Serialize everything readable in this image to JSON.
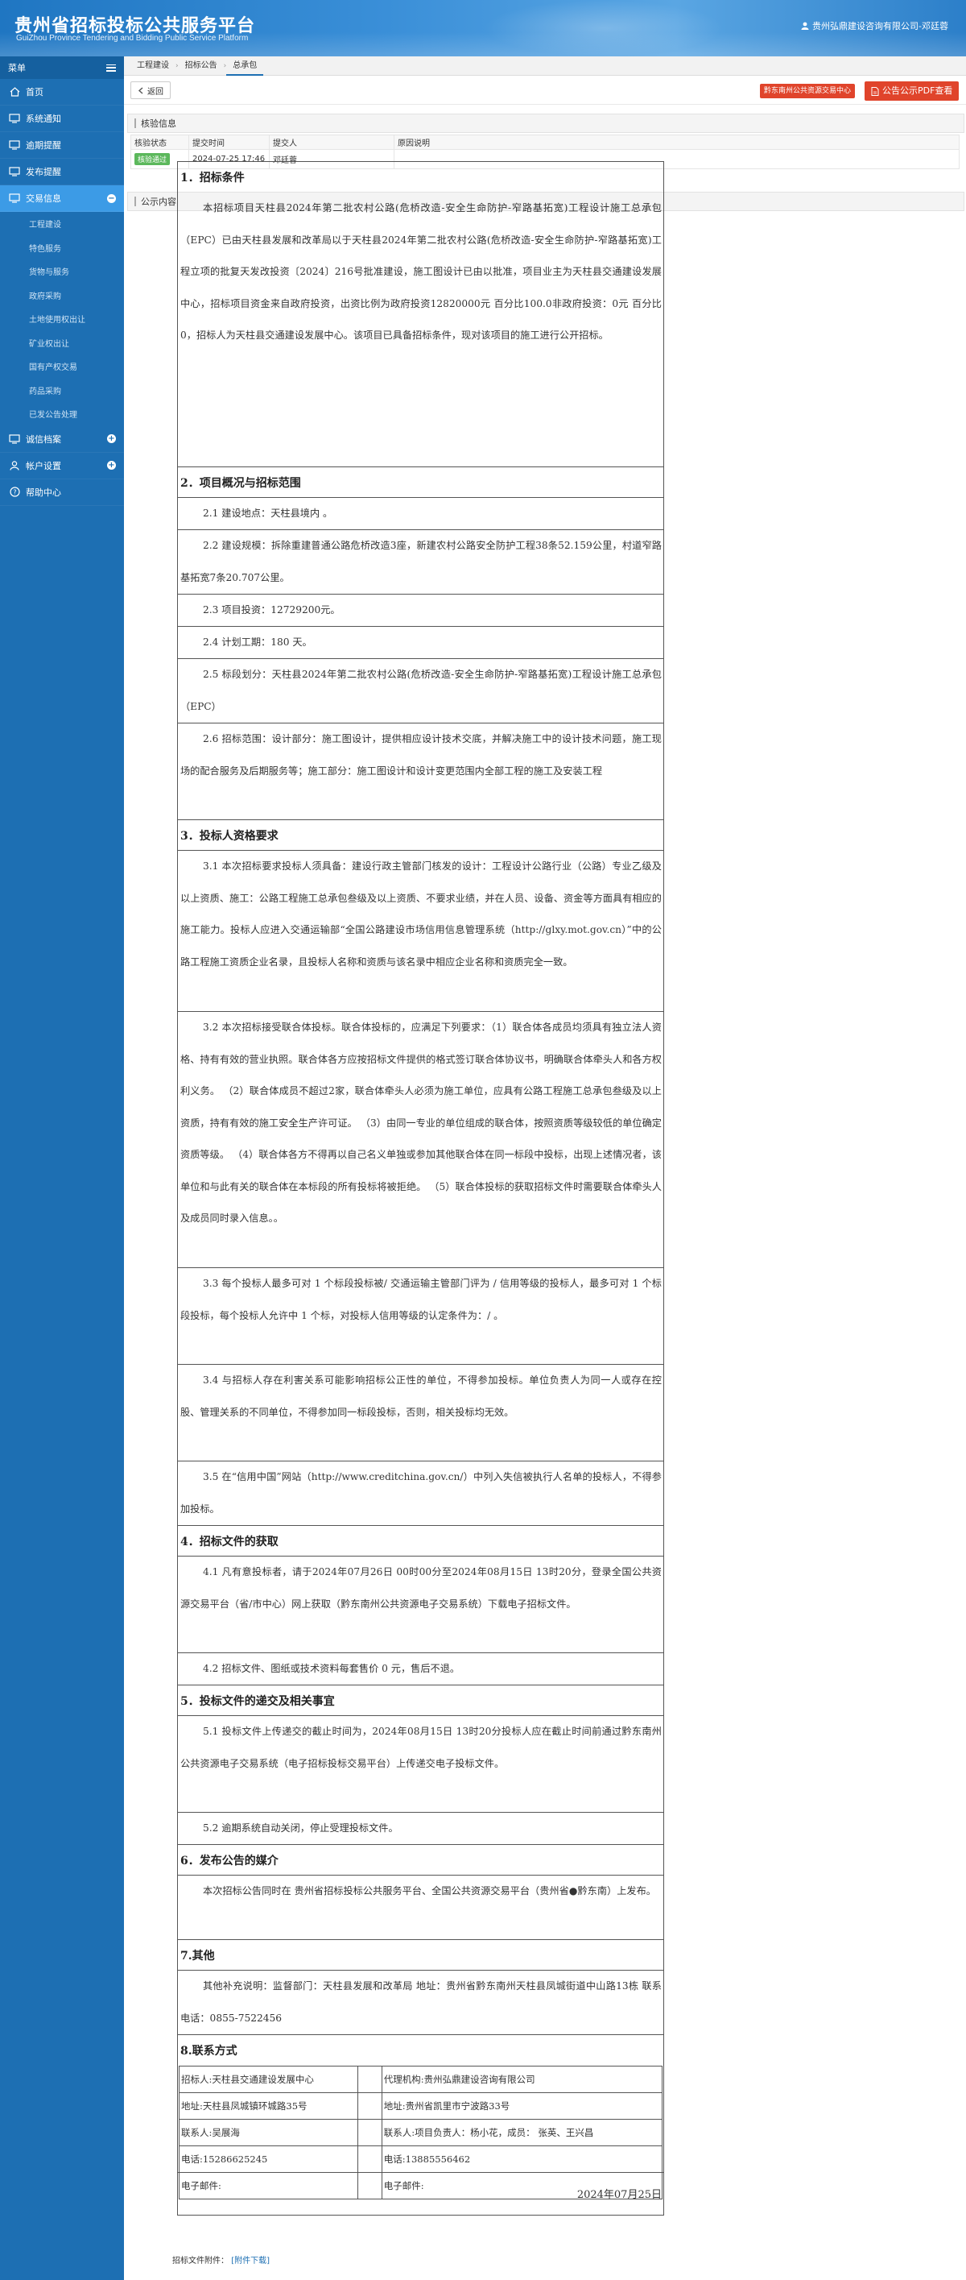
{
  "header": {
    "title": "贵州省招标投标公共服务平台",
    "subtitle": "GuiZhou Province Tendering and Bidding Public Service Platform",
    "user": "贵州弘鼎建设咨询有限公司-邓廷蓉"
  },
  "sidebar": {
    "menu_label": "菜单",
    "items": [
      {
        "label": "首页",
        "icon": "home-icon"
      },
      {
        "label": "系统通知",
        "icon": "monitor-icon"
      },
      {
        "label": "逾期提醒",
        "icon": "monitor-icon"
      },
      {
        "label": "发布提醒",
        "icon": "monitor-icon"
      },
      {
        "label": "交易信息",
        "icon": "monitor-icon"
      }
    ],
    "sub_items": [
      "工程建设",
      "特色服务",
      "货物与服务",
      "政府采购",
      "土地使用权出让",
      "矿业权出让",
      "国有产权交易",
      "药品采购",
      "已发公告处理"
    ],
    "bottom_items": [
      {
        "label": "诚信档案",
        "icon": "monitor-icon"
      },
      {
        "label": "帐户设置",
        "icon": "user-icon"
      },
      {
        "label": "帮助中心",
        "icon": "question-icon"
      }
    ]
  },
  "breadcrumb": [
    "工程建设",
    "招标公告",
    "总承包"
  ],
  "toolbar": {
    "back_label": "返回",
    "verify_label": "黔东南州公共资源交易中心",
    "pdf_label": "公告公示PDF查看"
  },
  "verify_section": {
    "title": "核验信息",
    "columns": [
      "核验状态",
      "提交时间",
      "提交人",
      "原因说明"
    ],
    "row": {
      "status": "核验通过",
      "time": "2024-07-25 17:46",
      "submitter": "邓廷蓉",
      "reason": ""
    }
  },
  "notice_section": {
    "title": "公示内容"
  },
  "document": {
    "s1_title": "1．招标条件",
    "s1_p1": "本招标项目天柱县2024年第二批农村公路(危桥改造-安全生命防护-窄路基拓宽)工程设计施工总承包（EPC）已由天柱县发展和改革局以于天柱县2024年第二批农村公路(危桥改造-安全生命防护-窄路基拓宽)工程立项的批复天发改投资〔2024〕216号批准建设，施工图设计已由以批准，项目业主为天柱县交通建设发展中心，招标项目资金来自政府投资，出资比例为政府投资12820000元 百分比100.0非政府投资：0元 百分比0，招标人为天柱县交通建设发展中心。该项目已具备招标条件，现对该项目的施工进行公开招标。",
    "s2_title": "2．项目概况与招标范围",
    "s2_p1": "2.1 建设地点：天柱县境内 。",
    "s2_p2": "2.2 建设规模：拆除重建普通公路危桥改造3座，新建农村公路安全防护工程38条52.159公里，村道窄路基拓宽7条20.707公里。",
    "s2_p3": "2.3 项目投资：12729200元。",
    "s2_p4": "2.4 计划工期：180 天。",
    "s2_p5": "2.5 标段划分：天柱县2024年第二批农村公路(危桥改造-安全生命防护-窄路基拓宽)工程设计施工总承包（EPC）",
    "s2_p6": "2.6 招标范围：设计部分：施工图设计，提供相应设计技术交底，并解决施工中的设计技术问题，施工现场的配合服务及后期服务等；施工部分：施工图设计和设计变更范围内全部工程的施工及安装工程",
    "s3_title": "3．投标人资格要求",
    "s3_p1": "3.1 本次招标要求投标人须具备：建设行政主管部门核发的设计：工程设计公路行业（公路）专业乙级及以上资质、施工：公路工程施工总承包叁级及以上资质、不要求业绩，并在人员、设备、资金等方面具有相应的施工能力。投标人应进入交通运输部“全国公路建设市场信用信息管理系统（http://glxy.mot.gov.cn）”中的公路工程施工资质企业名录，且投标人名称和资质与该名录中相应企业名称和资质完全一致。",
    "s3_p2": "3.2 本次招标接受联合体投标。联合体投标的，应满足下列要求：（1）联合体各成员均须具有独立法人资格、持有有效的营业执照。联合体各方应按招标文件提供的格式签订联合体协议书，明确联合体牵头人和各方权利义务。 （2）联合体成员不超过2家，联合体牵头人必须为施工单位，应具有公路工程施工总承包叁级及以上资质，持有有效的施工安全生产许可证。 （3）由同一专业的单位组成的联合体，按照资质等级较低的单位确定资质等级。 （4）联合体各方不得再以自己名义单独或参加其他联合体在同一标段中投标，出现上述情况者，该单位和与此有关的联合体在本标段的所有投标将被拒绝。 （5）联合体投标的获取招标文件时需要联合体牵头人及成员同时录入信息。。",
    "s3_p3": "3.3 每个投标人最多可对 1 个标段投标被/ 交通运输主管部门评为 / 信用等级的投标人，最多可对 1 个标段投标，每个投标人允许中  1  个标，对投标人信用等级的认定条件为：/ 。",
    "s3_p4": "3.4 与招标人存在利害关系可能影响招标公正性的单位，不得参加投标。单位负责人为同一人或存在控股、管理关系的不同单位，不得参加同一标段投标，否则，相关投标均无效。",
    "s3_p5": "3.5 在“信用中国”网站（http://www.creditchina.gov.cn/）中列入失信被执行人名单的投标人，不得参加投标。",
    "s4_title": "4．招标文件的获取",
    "s4_p1": "4.1 凡有意投标者，请于2024年07月26日 00时00分至2024年08月15日 13时20分，登录全国公共资源交易平台（省/市中心）网上获取（黔东南州公共资源电子交易系统）下载电子招标文件。",
    "s4_p2": "4.2 招标文件、图纸或技术资料每套售价 0 元，售后不退。",
    "s5_title": "5．投标文件的递交及相关事宜",
    "s5_p1": "5.1 投标文件上传递交的截止时间为，2024年08月15日 13时20分投标人应在截止时间前通过黔东南州公共资源电子交易系统（电子招标投标交易平台）上传递交电子投标文件。",
    "s5_p2": "5.2 逾期系统自动关闭，停止受理投标文件。",
    "s6_title": "6．发布公告的媒介",
    "s6_p1": "本次招标公告同时在 贵州省招标投标公共服务平台、全国公共资源交易平台（贵州省●黔东南）上发布。",
    "s7_title": "7.其他",
    "s7_p1": "其他补充说明：监督部门：天柱县发展和改革局 地址：贵州省黔东南州天柱县凤城街道中山路13栋 联系电话：0855-7522456",
    "s8_title": "8.联系方式",
    "contact": [
      [
        "招标人:天柱县交通建设发展中心",
        "代理机构:贵州弘鼎建设咨询有限公司"
      ],
      [
        "地址:天柱县凤城镇环城路35号",
        "地址:贵州省凯里市宁波路33号"
      ],
      [
        "联系人:吴展海",
        "联系人:项目负责人：杨小花，成员： 张英、王兴昌"
      ],
      [
        "电话:15286625245",
        "电话:13885556462"
      ],
      [
        "电子邮件:",
        "电子邮件:"
      ]
    ],
    "date": "2024年07月25日"
  },
  "footer": {
    "label": "招标文件附件：",
    "link": "[附件下载]"
  }
}
